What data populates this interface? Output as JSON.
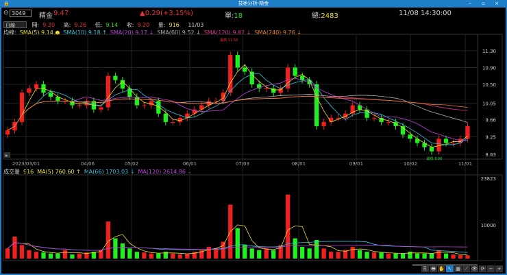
{
  "window": {
    "title": "技術分析-精金"
  },
  "quote": {
    "code": "3049",
    "name": "精金",
    "price": "9.47",
    "change": "▲0.29(+3.15%)",
    "unit_label": "單:",
    "unit": "18",
    "total_label": "總:",
    "total": "2483",
    "time": "11/08 14:30:00"
  },
  "ohlc": {
    "period": "日線",
    "open_label": "開:",
    "open": "9.20",
    "high_label": "高:",
    "high": "9.26",
    "low_label": "低:",
    "low": "9.14",
    "close_label": "收:",
    "close": "9.20",
    "vol_label": "量:",
    "vol": "916",
    "date": "11/03"
  },
  "ma": {
    "label": "均線:",
    "items": [
      {
        "text": "SMA(5) 9.14",
        "color": "#f0e030",
        "arrow": "●"
      },
      {
        "text": "SMA(10) 9.18",
        "color": "#30c8e0",
        "arrow": "↑"
      },
      {
        "text": "SMA(20) 9.17",
        "color": "#c040e0",
        "arrow": "↓"
      },
      {
        "text": "SMA(60) 9.52",
        "color": "#b0b0b0",
        "arrow": "↓"
      },
      {
        "text": "SMA(120) 9.87",
        "color": "#e03090",
        "arrow": "↓"
      },
      {
        "text": "SMA(240) 9.76",
        "color": "#f08020",
        "arrow": "↓"
      }
    ]
  },
  "volume": {
    "label": "成交量",
    "value": "916",
    "items": [
      {
        "text": "MA(5) 760.60",
        "color": "#f0e030",
        "arrow": "↑"
      },
      {
        "text": "MA(66) 1703.03",
        "color": "#30c8e0",
        "arrow": "↓"
      },
      {
        "text": "MA(120) 2614.86",
        "color": "#c040e0",
        "arrow": "↓"
      }
    ]
  },
  "chart_data": {
    "type": "candlestick",
    "price_ticks": [
      "11.30",
      "10.90",
      "10.50",
      "10.05",
      "9.66",
      "9.25",
      "8.83"
    ],
    "date_ticks": [
      "2023/03/01",
      "04/06",
      "05/02",
      "06/01",
      "07/03",
      "08/01",
      "09/01",
      "10/02",
      "11/01"
    ],
    "volume_ticks": [
      "23823",
      "10000"
    ],
    "high_label": "最高 11.50",
    "low_label": "最低 8.86",
    "closes": [
      9.4,
      9.6,
      10.3,
      10.4,
      10.5,
      10.3,
      10.2,
      10.1,
      10.1,
      10.0,
      10.0,
      10.1,
      9.9,
      9.95,
      10.7,
      10.6,
      10.4,
      10.2,
      10.0,
      10.0,
      10.1,
      9.8,
      9.6,
      9.6,
      9.7,
      9.8,
      9.9,
      10.0,
      10.1,
      10.1,
      10.3,
      11.2,
      10.9,
      10.8,
      10.5,
      10.4,
      10.4,
      10.3,
      10.4,
      10.9,
      10.7,
      10.6,
      10.5,
      9.5,
      9.6,
      9.7,
      9.7,
      9.8,
      10.0,
      9.9,
      9.7,
      9.7,
      9.6,
      9.6,
      9.5,
      9.3,
      9.2,
      9.1,
      9.0,
      8.9,
      9.2,
      9.1,
      9.1,
      9.2,
      9.5
    ],
    "volumes": [
      3000,
      6500,
      4000,
      2500,
      2000,
      1800,
      1500,
      1500,
      2500,
      1200,
      1500,
      1800,
      2000,
      2500,
      11000,
      6000,
      4500,
      3000,
      2000,
      1800,
      1500,
      1500,
      2000,
      1500,
      1200,
      1500,
      2000,
      2500,
      3500,
      3000,
      5000,
      16000,
      9000,
      4000,
      3000,
      2500,
      3000,
      2500,
      4000,
      19000,
      6000,
      3500,
      3000,
      5500,
      3000,
      2000,
      2000,
      2500,
      3500,
      2500,
      2000,
      1800,
      1800,
      1500,
      1500,
      1500,
      2000,
      1500,
      1500,
      1500,
      2500,
      1500,
      1200,
      1000,
      916
    ]
  },
  "toolbar": [
    "⎘",
    "🖶",
    "✋",
    "↖",
    "▦",
    "⟋",
    "👁",
    "⟳",
    "−",
    "+"
  ]
}
